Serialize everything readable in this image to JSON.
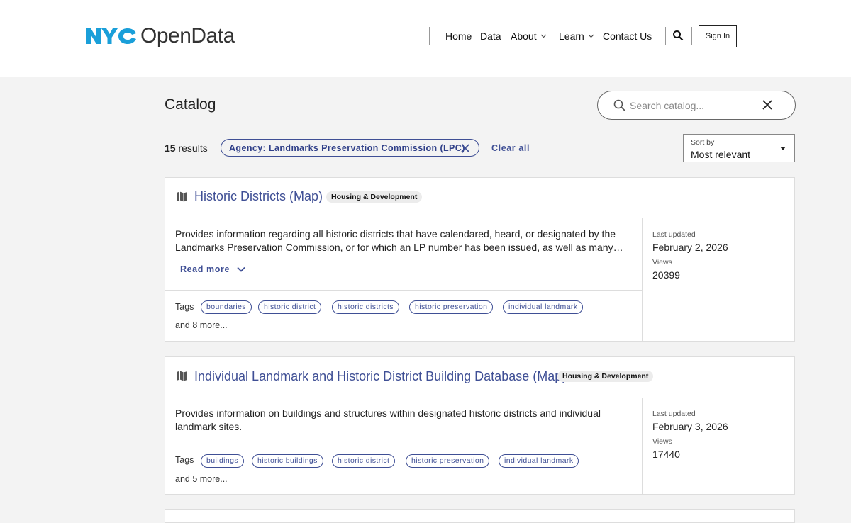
{
  "header": {
    "logo_nyc": "NYC",
    "logo_text": "OpenData",
    "nav": [
      {
        "label": "Home"
      },
      {
        "label": "Data"
      },
      {
        "label": "About"
      },
      {
        "label": "Learn"
      },
      {
        "label": "Contact Us"
      }
    ],
    "signin_label": "Sign In"
  },
  "catalog": {
    "title": "Catalog",
    "search_placeholder": "Search catalog...",
    "results_count": "15",
    "results_suffix": "results",
    "filter_chip": "Agency: Landmarks Preservation Commission (LPC)",
    "clear_all": "Clear all",
    "sort_label": "Sort by",
    "sort_value": "Most relevant"
  },
  "datasets": [
    {
      "title": "Historic Districts (Map)",
      "category": "Housing & Development",
      "description": "Provides information regarding all historic districts that have calendared, heard, or designated by the Landmarks Preservation Commission, or for which an LP number has been issued, as well as many…",
      "read_more": "Read more",
      "tags_label": "Tags",
      "tags": [
        "boundaries",
        "historic district",
        "historic districts",
        "historic preservation",
        "individual landmark"
      ],
      "more_tags": "and 8 more...",
      "last_updated_label": "Last updated",
      "last_updated": "February 2, 2026",
      "views_label": "Views",
      "views": "20399"
    },
    {
      "title": "Individual Landmark and Historic District Building Database (Map)",
      "category": "Housing & Development",
      "description": "Provides information on buildings and structures within designated historic districts and individual landmark sites.",
      "tags_label": "Tags",
      "tags": [
        "buildings",
        "historic buildings",
        "historic district",
        "historic preservation",
        "individual landmark"
      ],
      "more_tags": "and 5 more...",
      "last_updated_label": "Last updated",
      "last_updated": "February 3, 2026",
      "views_label": "Views",
      "views": "17440"
    }
  ],
  "colors": {
    "accent": "#3f4f95",
    "logo_blue": "#1a9fd9",
    "background": "#f3f3f3"
  }
}
